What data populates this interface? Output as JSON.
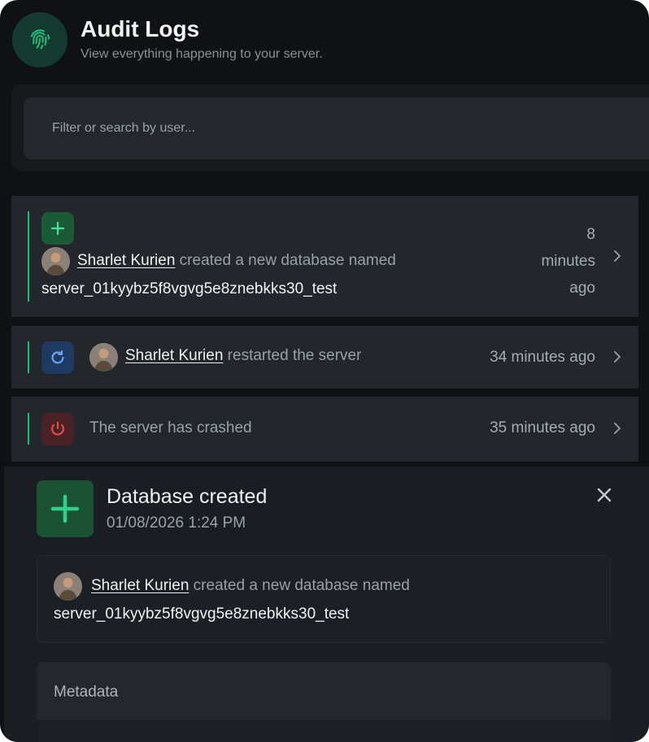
{
  "header": {
    "title": "Audit Logs",
    "subtitle": "View everything happening to your server.",
    "icon": "fingerprint-icon"
  },
  "search": {
    "placeholder": "Filter or search by user...",
    "value": ""
  },
  "logs": [
    {
      "action": "create",
      "icon": "plus-icon",
      "user": "Sharlet Kurien",
      "text": " created a new database named",
      "target": "server_01kyybz5f8vgvg5e8znebkks30_test",
      "time_lines": [
        "8",
        "minutes",
        "ago"
      ]
    },
    {
      "action": "restart",
      "icon": "restart-icon",
      "user": "Sharlet Kurien",
      "text": " restarted the server",
      "time": "34 minutes ago"
    },
    {
      "action": "crash",
      "icon": "power-icon",
      "text": "The server has crashed",
      "time": "35 minutes ago"
    }
  ],
  "detail": {
    "title": "Database created",
    "date": "01/08/2026 1:24 PM",
    "user": "Sharlet Kurien",
    "text": " created a new database named",
    "target": "server_01kyybz5f8vgvg5e8znebkks30_test",
    "metadata_label": "Metadata"
  },
  "colors": {
    "accent_green": "#1fbf7a",
    "restart_blue": "#4f8fe0",
    "crash_red": "#e04848",
    "background": "#0f1113",
    "row": "#23272b"
  }
}
